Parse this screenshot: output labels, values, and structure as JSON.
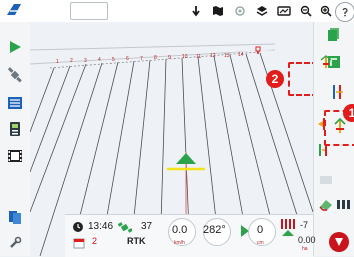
{
  "topbar": {
    "icons": [
      "brand-logo-icon",
      "tractor-icon",
      "map-layer-icon",
      "satellite-icon",
      "layers-icon",
      "overlay-icon",
      "zoom-out-icon",
      "zoom-in-icon",
      "help-icon"
    ]
  },
  "field": {
    "row_labels": [
      "1",
      "2",
      "3",
      "4",
      "5",
      "6",
      "7",
      "8",
      "9",
      "10",
      "11",
      "12",
      "13",
      "14"
    ]
  },
  "callouts": {
    "badge_2": "2",
    "badge_1": "1"
  },
  "status": {
    "time": "13:46",
    "date_label": "2",
    "satellites": "37",
    "fix_mode": "RTK",
    "speed": "0.0",
    "speed_unit": "km/h",
    "heading": "282°",
    "offset": "0",
    "offset_unit": "cm",
    "section_value": "-7",
    "section_value2": "0.00",
    "section_unit": "ha"
  },
  "colors": {
    "accent_green": "#2aa34a",
    "alert_red": "#e21b1b",
    "brand_blue": "#1c62b8"
  }
}
